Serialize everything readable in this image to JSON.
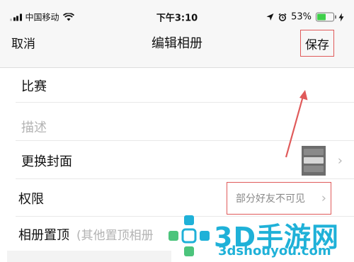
{
  "status_bar": {
    "carrier": "中国移动",
    "time": "下午3:10",
    "battery_percent": "53%",
    "battery_level": 0.53,
    "icons": [
      "signal-icon",
      "wifi-icon",
      "location-arrow-icon",
      "alarm-icon",
      "battery-icon",
      "charging-bolt-icon"
    ]
  },
  "nav": {
    "cancel_label": "取消",
    "title": "编辑相册",
    "save_label": "保存"
  },
  "form": {
    "album_name": "比赛",
    "description_placeholder": "描述",
    "cover_label": "更换封面",
    "permission_label": "权限",
    "permission_value": "部分好友不可见",
    "pin_label": "相册置顶",
    "pin_hint": "(其他置顶相册"
  },
  "watermark": {
    "brand": "3D手游网",
    "url": "3dshouyou.com"
  },
  "colors": {
    "annotation_red": "#e05a5a",
    "watermark_blue": "#1fb1d8",
    "watermark_green": "#4cc47c",
    "battery_green": "#3fcf4a"
  }
}
